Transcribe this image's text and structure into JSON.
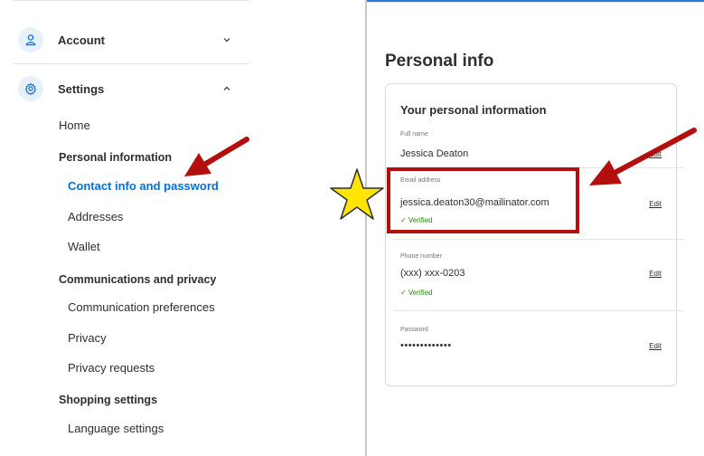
{
  "sidebar": {
    "account_label": "Account",
    "settings_label": "Settings",
    "home": "Home",
    "personal_information_header": "Personal information",
    "contact_info": "Contact info and password",
    "addresses": "Addresses",
    "wallet": "Wallet",
    "communications_header": "Communications and privacy",
    "communication_preferences": "Communication preferences",
    "privacy": "Privacy",
    "privacy_requests": "Privacy requests",
    "shopping_header": "Shopping settings",
    "language_settings": "Language settings"
  },
  "main": {
    "page_title": "Personal info",
    "card_title": "Your personal information",
    "edit_label": "Edit",
    "verified_label": "✓ Verified",
    "full_name": {
      "label": "Full name",
      "value": "Jessica Deaton"
    },
    "email": {
      "label": "Email address",
      "value": "jessica.deaton30@mailinator.com"
    },
    "phone": {
      "label": "Phone number",
      "value": "(xxx) xxx-0203"
    },
    "password": {
      "label": "Password",
      "value": "•••••••••••••"
    }
  },
  "annotations": {
    "arrow_color": "#b30f0f",
    "star_color": "#ffe500"
  }
}
